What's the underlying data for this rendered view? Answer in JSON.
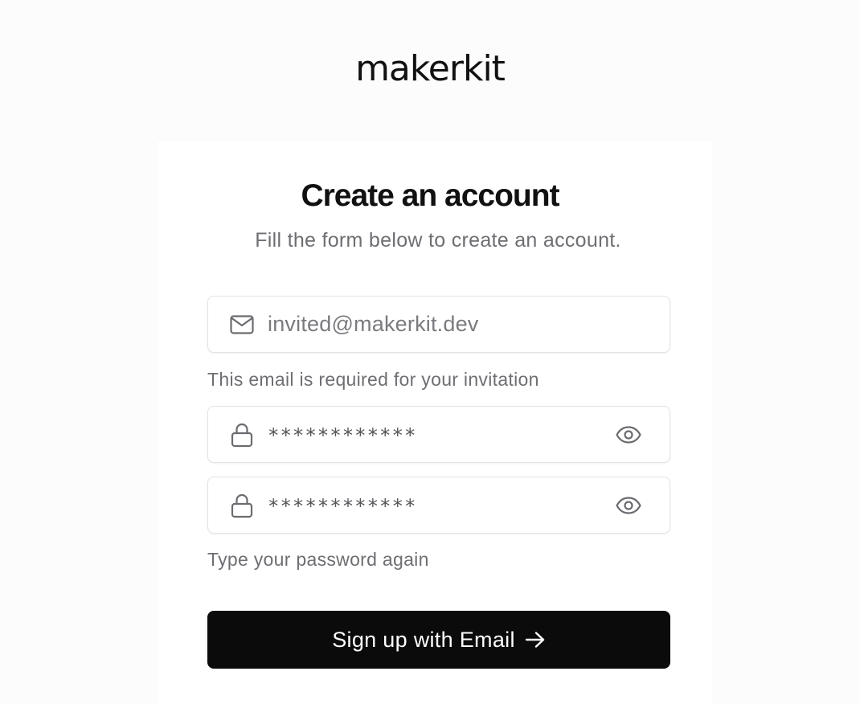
{
  "brand": {
    "logo_text": "makerkit"
  },
  "form": {
    "title": "Create an account",
    "subtitle": "Fill the form below to create an account.",
    "email": {
      "value": "invited@makerkit.dev",
      "icon": "mail-icon",
      "hint": "This email is required for your invitation"
    },
    "password": {
      "value": "************",
      "icon": "lock-icon",
      "toggle_icon": "eye-icon"
    },
    "repeat_password": {
      "value": "************",
      "icon": "lock-icon",
      "toggle_icon": "eye-icon",
      "hint": "Type your password again"
    },
    "submit": {
      "label": "Sign up with Email",
      "icon": "arrow-right-icon"
    }
  },
  "colors": {
    "background": "#fcfcfc",
    "card": "#ffffff",
    "button": "#0b0b0c",
    "muted_text": "#6e6e73"
  }
}
